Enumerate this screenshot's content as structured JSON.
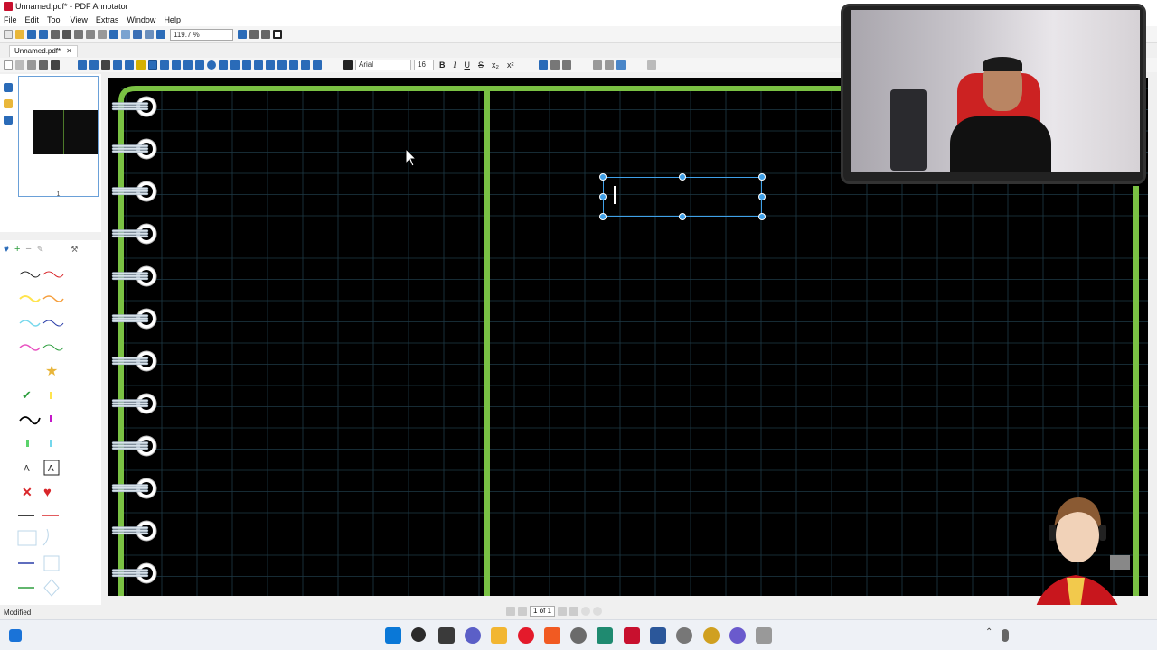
{
  "window": {
    "title": "Unnamed.pdf* - PDF Annotator"
  },
  "menu": [
    "File",
    "Edit",
    "Tool",
    "View",
    "Extras",
    "Window",
    "Help"
  ],
  "toolbar": {
    "zoom_value": "119.7 %"
  },
  "tabs": [
    {
      "label": "Unnamed.pdf*"
    }
  ],
  "format": {
    "font_name": "Arial",
    "font_size": "16",
    "bold": "B",
    "italic": "I",
    "underline": "U",
    "strike": "S",
    "subscript": "x₂",
    "superscript": "x²"
  },
  "thumbnails": [
    {
      "page": "1"
    }
  ],
  "status": {
    "text": "Modified"
  },
  "pager": {
    "label": "1 of 1"
  },
  "colors": {
    "accent": "#3fa0e8",
    "notebook_green": "#7ac143",
    "canvas_bg": "#000000",
    "grid": "#1e3a46"
  },
  "icons": {
    "selection": "text-box-selection",
    "cursor": "mouse-pointer-icon"
  }
}
